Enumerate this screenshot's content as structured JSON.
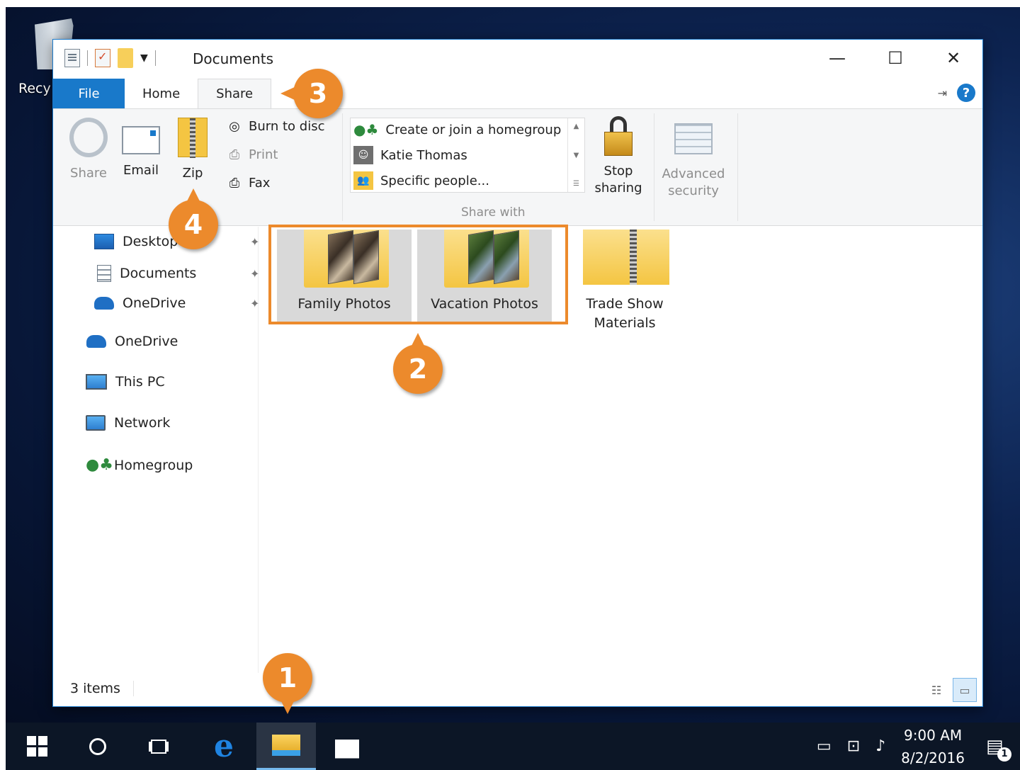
{
  "desktop": {
    "recycle_label": "Recy"
  },
  "window": {
    "title": "Documents",
    "controls": {
      "minimize": "—",
      "maximize": "☐",
      "close": "✕"
    }
  },
  "tabs": {
    "file": "File",
    "home": "Home",
    "share": "Share",
    "help": "?"
  },
  "ribbon": {
    "send": {
      "share": "Share",
      "email": "Email",
      "zip": "Zip",
      "burn": "Burn to disc",
      "print": "Print",
      "fax": "Fax"
    },
    "share_with": {
      "items": [
        "Create or join a homegroup",
        "Katie Thomas",
        "Specific people..."
      ],
      "group_label": "Share with",
      "stop_sharing": [
        "Stop",
        "sharing"
      ],
      "advanced_security": [
        "Advanced",
        "security"
      ]
    }
  },
  "nav": {
    "quick_access": [
      "Desktop",
      "Documents",
      "OneDrive"
    ],
    "items": [
      "OneDrive",
      "This PC",
      "Network",
      "Homegroup"
    ]
  },
  "files": [
    {
      "name": "Family Photos",
      "selected": true
    },
    {
      "name": "Vacation Photos",
      "selected": true
    },
    {
      "name": "Trade Show Materials",
      "name_lines": [
        "Trade Show",
        "Materials"
      ],
      "selected": false
    }
  ],
  "status": {
    "count": "3 items"
  },
  "callouts": {
    "one": "1",
    "two": "2",
    "three": "3",
    "four": "4"
  },
  "taskbar": {
    "time": "9:00 AM",
    "date": "8/2/2016",
    "notification_count": "1"
  },
  "colors": {
    "accent": "#1979ca",
    "callout": "#ec8a2c",
    "taskbar": "#0c1626"
  }
}
